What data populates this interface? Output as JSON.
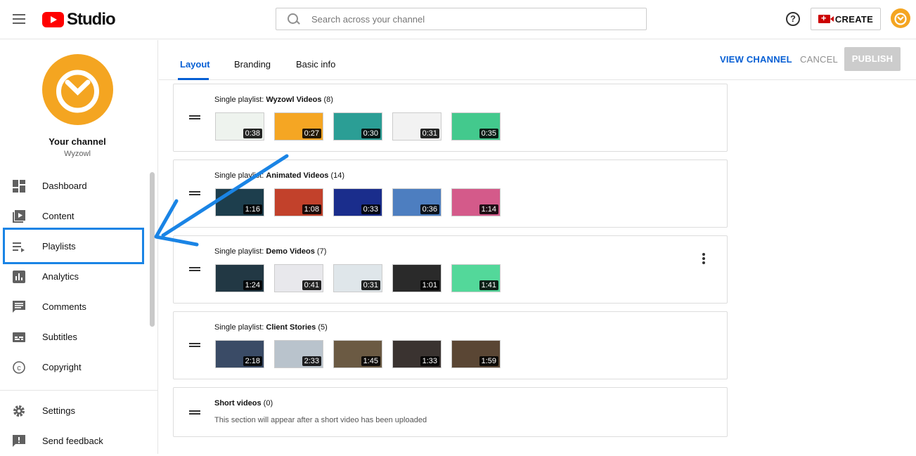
{
  "header": {
    "logo_text": "Studio",
    "search_placeholder": "Search across your channel",
    "create_label": "CREATE",
    "help_label": "?"
  },
  "sidebar": {
    "channel_title": "Your channel",
    "channel_name": "Wyzowl",
    "items": [
      {
        "label": "Dashboard",
        "icon": "dashboard-icon"
      },
      {
        "label": "Content",
        "icon": "content-icon"
      },
      {
        "label": "Playlists",
        "icon": "playlists-icon"
      },
      {
        "label": "Analytics",
        "icon": "analytics-icon"
      },
      {
        "label": "Comments",
        "icon": "comments-icon"
      },
      {
        "label": "Subtitles",
        "icon": "subtitles-icon"
      },
      {
        "label": "Copyright",
        "icon": "copyright-icon"
      },
      {
        "label": "Settings",
        "icon": "settings-icon"
      },
      {
        "label": "Send feedback",
        "icon": "feedback-icon"
      }
    ]
  },
  "tabs": [
    {
      "label": "Layout",
      "active": true
    },
    {
      "label": "Branding",
      "active": false
    },
    {
      "label": "Basic info",
      "active": false
    }
  ],
  "actions": {
    "view_channel": "VIEW CHANNEL",
    "cancel": "CANCEL",
    "publish": "PUBLISH"
  },
  "sections": [
    {
      "prefix": "Single playlist: ",
      "name": "Wyzowl Videos",
      "count": " (8)",
      "videos": [
        {
          "dur": "0:38",
          "bg": "#eef3ee"
        },
        {
          "dur": "0:27",
          "bg": "#f5a623"
        },
        {
          "dur": "0:30",
          "bg": "#2b9e95"
        },
        {
          "dur": "0:31",
          "bg": "#f2f2f2"
        },
        {
          "dur": "0:35",
          "bg": "#43c98d"
        }
      ]
    },
    {
      "prefix": "Single playlist: ",
      "name": "Animated Videos",
      "count": " (14)",
      "videos": [
        {
          "dur": "1:16",
          "bg": "#1d3e4d"
        },
        {
          "dur": "1:08",
          "bg": "#c2412b"
        },
        {
          "dur": "0:33",
          "bg": "#1a2d8c"
        },
        {
          "dur": "0:36",
          "bg": "#4d7ec0"
        },
        {
          "dur": "1:14",
          "bg": "#d45a8a"
        }
      ]
    },
    {
      "prefix": "Single playlist: ",
      "name": "Demo Videos",
      "count": " (7)",
      "videos": [
        {
          "dur": "1:24",
          "bg": "#223844"
        },
        {
          "dur": "0:41",
          "bg": "#e8e8ec"
        },
        {
          "dur": "0:31",
          "bg": "#dfe6ea"
        },
        {
          "dur": "1:01",
          "bg": "#2a2a2a"
        },
        {
          "dur": "1:41",
          "bg": "#53d89a"
        }
      ]
    },
    {
      "prefix": "Single playlist: ",
      "name": "Client Stories",
      "count": " (5)",
      "videos": [
        {
          "dur": "2:18",
          "bg": "#3a4b66"
        },
        {
          "dur": "2:33",
          "bg": "#b9c3cc"
        },
        {
          "dur": "1:45",
          "bg": "#6b5a43"
        },
        {
          "dur": "1:33",
          "bg": "#3a3330"
        },
        {
          "dur": "1:59",
          "bg": "#5a4634"
        }
      ]
    }
  ],
  "short_videos": {
    "name": "Short videos",
    "count": " (0)",
    "note": "This section will appear after a short video has been uploaded"
  },
  "colors": {
    "accent": "#065fd4",
    "brand_red": "#ff0000",
    "avatar": "#f4a521",
    "highlight": "#1a84e5"
  }
}
